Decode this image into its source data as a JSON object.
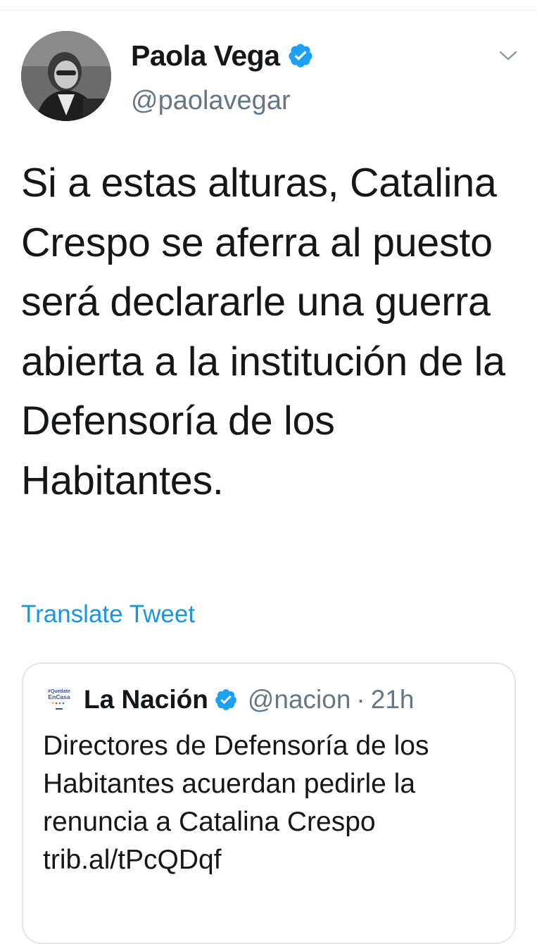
{
  "tweet": {
    "author": {
      "display_name": "Paola Vega",
      "handle": "@paolavegar",
      "verified_icon": "verified-badge-icon",
      "avatar_icon": "profile-photo"
    },
    "menu_icon": "chevron-down-icon",
    "text": "Si a estas alturas, Catalina Crespo se aferra al puesto será declararle una guerra abierta a la institución de la Defensoría de los Habitantes.",
    "translate_label": "Translate Tweet",
    "quoted": {
      "avatar_text_top": "#Quedate",
      "avatar_text_bottom": "EnCasa",
      "display_name": "La Nación",
      "handle": "@nacion",
      "separator": "·",
      "time": "21h",
      "text": "Directores de Defensoría de los Habitantes acuerdan pedirle la renuncia a Catalina Crespo trib.al/tPcQDqf"
    }
  },
  "colors": {
    "text": "#14171a",
    "muted": "#657786",
    "link": "#1b95e0",
    "verified": "#1da1f2",
    "border": "#e1e8ed"
  }
}
